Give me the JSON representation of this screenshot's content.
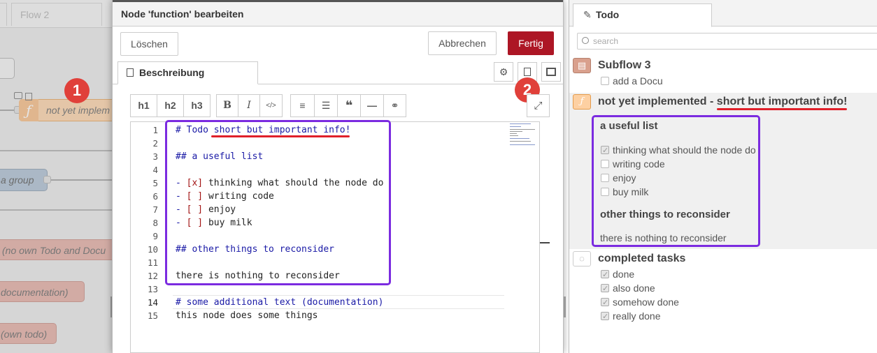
{
  "workspace": {
    "tab_label": "Flow 2",
    "nodes": [
      "not yet implem",
      "a group",
      "(no own Todo and Docu",
      "documentation)",
      "(own todo)"
    ],
    "node_icon": "function-icon"
  },
  "tray": {
    "title": "Node 'function' bearbeiten",
    "delete_label": "Löschen",
    "cancel_label": "Abbrechen",
    "done_label": "Fertig",
    "tab_label": "Beschreibung",
    "icons": [
      "gear-icon",
      "document-icon",
      "frame-icon",
      "expand-icon"
    ],
    "toolbar": {
      "headings": [
        "h1",
        "h2",
        "h3"
      ],
      "format": [
        "B",
        "I",
        "</>"
      ],
      "blocks": [
        "ordered-list-icon",
        "unordered-list-icon",
        "quote-icon",
        "rule-icon",
        "link-icon"
      ]
    },
    "editor": {
      "lines": [
        "# Todo short but important info!",
        "",
        "## a useful list",
        "",
        "- [x] thinking what should the node do",
        "- [ ] writing code",
        "- [ ] enjoy",
        "- [ ] buy milk",
        "",
        "## other things to reconsider",
        "",
        "there is nothing to reconsider",
        "",
        "# some additional text (documentation)",
        "this node does some things"
      ]
    }
  },
  "sidebar": {
    "tab_label": "Todo",
    "search_placeholder": "search",
    "groups": {
      "g1": {
        "title": "Subflow 3",
        "items": [
          {
            "label": "add a Docu",
            "checked": false
          }
        ]
      },
      "g2": {
        "title_prefix": "not yet implemented - ",
        "title_highlight": "short but important info!",
        "sub1": "a useful list",
        "items": [
          {
            "label": "thinking what should the node do",
            "checked": true
          },
          {
            "label": "writing code",
            "checked": false
          },
          {
            "label": "enjoy",
            "checked": false
          },
          {
            "label": "buy milk",
            "checked": false
          }
        ],
        "sub2": "other things to reconsider",
        "note": "there is nothing to reconsider"
      },
      "g3": {
        "title": "completed tasks",
        "items": [
          {
            "label": "done",
            "checked": true
          },
          {
            "label": "also done",
            "checked": true
          },
          {
            "label": "somehow done",
            "checked": true
          },
          {
            "label": "really done",
            "checked": true
          }
        ]
      }
    }
  },
  "annotations": {
    "badge1": "1",
    "badge2": "2"
  },
  "colors": {
    "accent_red": "#ad1625",
    "annotation_purple": "#7b2be0",
    "annotation_red": "#e0202a",
    "node_orange": "#fdd0a2"
  }
}
